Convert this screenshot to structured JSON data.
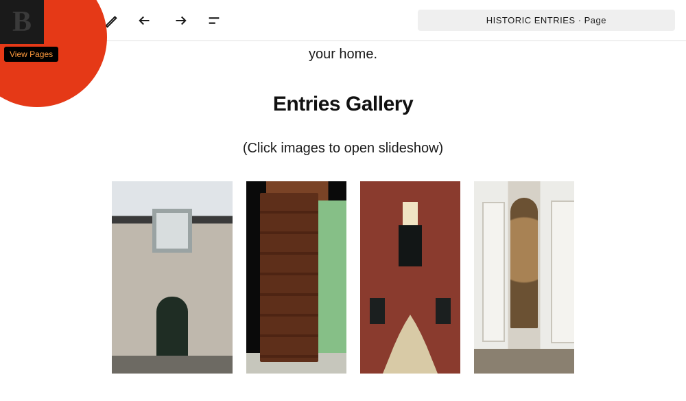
{
  "header": {
    "logo_letter": "B",
    "tooltip": "View Pages",
    "page_title": "HISTORIC ENTRIES · Page"
  },
  "toolbar": {
    "edit": "edit-icon",
    "undo": "undo-icon",
    "redo": "redo-icon",
    "list": "list-icon"
  },
  "content": {
    "intro_trailing": "your home.",
    "gallery_heading": "Entries Gallery",
    "gallery_sub": "(Click images to open slideshow)",
    "images": [
      {
        "name": "gallery-image-1",
        "alt": "stone building arched green door"
      },
      {
        "name": "gallery-image-2",
        "alt": "open brown paneled door"
      },
      {
        "name": "gallery-image-3",
        "alt": "brick rowhouse with stairs"
      },
      {
        "name": "gallery-image-4",
        "alt": "white double doors with glass panel"
      }
    ]
  }
}
